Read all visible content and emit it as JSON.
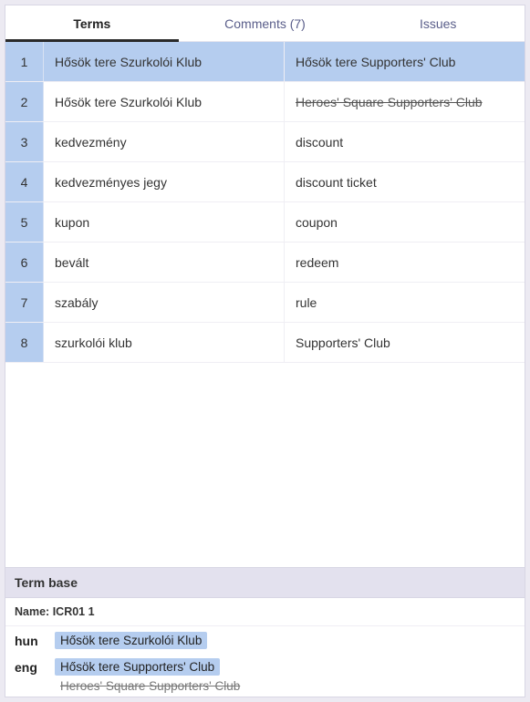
{
  "tabs": {
    "terms": "Terms",
    "comments": "Comments (7)",
    "issues": "Issues"
  },
  "rows": [
    {
      "n": "1",
      "src": "Hősök tere Szurkolói Klub",
      "tgt": "Hősök tere Supporters' Club",
      "selected": true,
      "strike": false
    },
    {
      "n": "2",
      "src": "Hősök tere Szurkolói Klub",
      "tgt": "Heroes' Square Supporters' Club",
      "selected": false,
      "strike": true
    },
    {
      "n": "3",
      "src": "kedvezmény",
      "tgt": "discount",
      "selected": false,
      "strike": false
    },
    {
      "n": "4",
      "src": "kedvezményes jegy",
      "tgt": "discount ticket",
      "selected": false,
      "strike": false
    },
    {
      "n": "5",
      "src": "kupon",
      "tgt": "coupon",
      "selected": false,
      "strike": false
    },
    {
      "n": "6",
      "src": "bevált",
      "tgt": "redeem",
      "selected": false,
      "strike": false
    },
    {
      "n": "7",
      "src": "szabály",
      "tgt": "rule",
      "selected": false,
      "strike": false
    },
    {
      "n": "8",
      "src": "szurkolói klub",
      "tgt": "Supporters' Club",
      "selected": false,
      "strike": false
    }
  ],
  "termbase": {
    "header": "Term base",
    "name_label": "Name:",
    "name_value": "ICR01 1",
    "langs": [
      {
        "code": "hun",
        "chips": [
          {
            "text": "Hősök tere Szurkolói Klub",
            "strike": false
          }
        ]
      },
      {
        "code": "eng",
        "chips": [
          {
            "text": "Hősök tere Supporters' Club",
            "strike": false
          },
          {
            "text": "Heroes' Square Supporters' Club",
            "strike": true
          }
        ]
      }
    ]
  }
}
